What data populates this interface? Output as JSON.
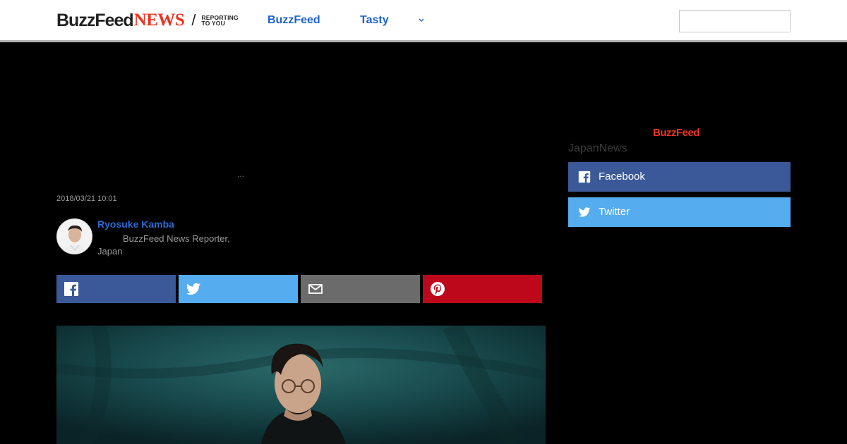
{
  "header": {
    "logo_buzz": "BuzzFeed",
    "logo_news": "NEWS",
    "logo_slash": "/",
    "tagline_line1": "REPORTING",
    "tagline_line2": "TO YOU",
    "nav": [
      {
        "label": "BuzzFeed"
      },
      {
        "label": "Tasty"
      }
    ],
    "search": {
      "placeholder": ""
    }
  },
  "article": {
    "ellipsis": "...",
    "timestamp": "2018/03/21 10:01",
    "author": {
      "name": "Ryosuke Kamba",
      "role": "BuzzFeed News Reporter, Japan"
    },
    "share_buttons": [
      {
        "icon": "facebook-icon",
        "color": "#3b5998"
      },
      {
        "icon": "twitter-icon",
        "color": "#55acee"
      },
      {
        "icon": "mail-icon",
        "color": "#6b6b6b"
      },
      {
        "icon": "pinterest-icon",
        "color": "#bd081c"
      }
    ]
  },
  "sidebar": {
    "logo": "BuzzFeed",
    "title": "JapanNews",
    "follow_buttons": [
      {
        "label": "Facebook",
        "icon": "facebook-icon",
        "color": "#3b5998"
      },
      {
        "label": "Twitter",
        "icon": "twitter-icon",
        "color": "#55acee"
      }
    ]
  },
  "colors": {
    "accent_blue": "#1a62cf",
    "brand_red": "#e32",
    "background": "#000000"
  }
}
